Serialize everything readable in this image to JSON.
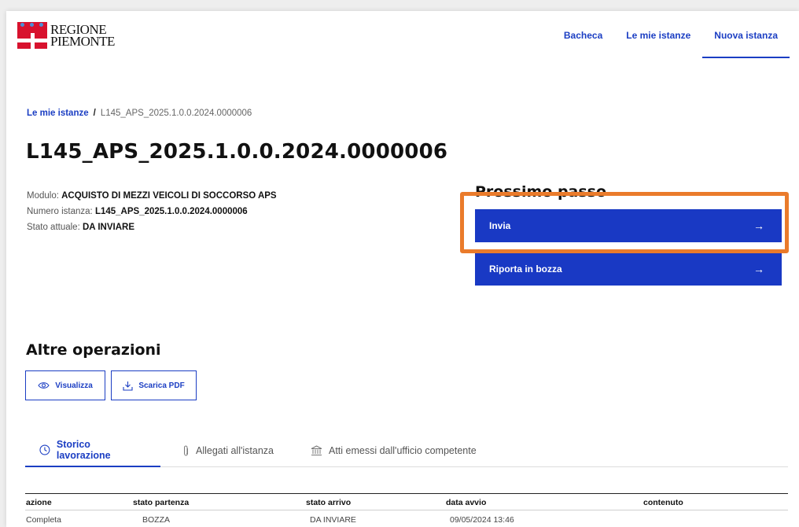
{
  "header": {
    "logo_line1": "REGIONE",
    "logo_line2": "PIEMONTE",
    "nav": [
      "Bacheca",
      "Le mie istanze",
      "Nuova istanza"
    ],
    "active_nav": "Nuova istanza"
  },
  "breadcrumb": {
    "link": "Le mie istanze",
    "separator": "/",
    "current": "L145_APS_2025.1.0.0.2024.0000006"
  },
  "title": "L145_APS_2025.1.0.0.2024.0000006",
  "info": {
    "modulo_label": "Modulo:",
    "modulo_value": "ACQUISTO DI MEZZI VEICOLI DI SOCCORSO APS",
    "numero_label": "Numero istanza:",
    "numero_value": "L145_APS_2025.1.0.0.2024.0000006",
    "stato_label": "Stato attuale:",
    "stato_value": "DA INVIARE"
  },
  "next_step": {
    "title": "Prossimo passo",
    "primary_label": "Invia",
    "secondary_label": "Riporta in bozza",
    "arrow": "→"
  },
  "other_ops": {
    "title": "Altre operazioni",
    "view_label": "Visualizza",
    "download_label": "Scarica PDF"
  },
  "tabs": [
    "Storico lavorazione",
    "Allegati all'istanza",
    "Atti emessi dall'ufficio competente"
  ],
  "table": {
    "columns": [
      "azione",
      "stato partenza",
      "stato arrivo",
      "data avvio",
      "contenuto"
    ],
    "rows": [
      [
        "Completa",
        "BOZZA",
        "DA INVIARE",
        "09/05/2024 13:46",
        ""
      ]
    ]
  },
  "colors": {
    "primary": "#1939c4",
    "highlight": "#ea7b2b",
    "logo_red": "#d8122e",
    "logo_blue": "#4a8fd6"
  },
  "icons": [
    "eye-icon",
    "download-icon",
    "clock-icon",
    "paperclip-icon",
    "bank-icon",
    "arrow-right-icon"
  ]
}
